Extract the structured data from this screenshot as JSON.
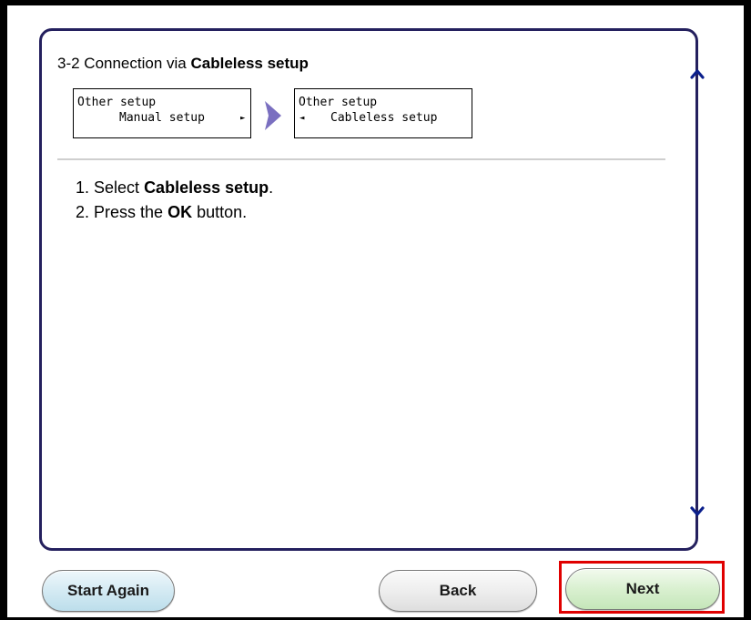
{
  "heading": {
    "prefix": "3-2 Connection via ",
    "bold": "Cableless setup"
  },
  "lcd_before": {
    "line1": "Other setup",
    "line2": "Manual setup",
    "arrow": "►"
  },
  "lcd_after": {
    "line1": "Other setup",
    "line2": "Cableless setup",
    "arrow": "◄"
  },
  "steps": [
    {
      "num": "1.",
      "pre": "Select ",
      "bold": "Cableless setup",
      "post": "."
    },
    {
      "num": "2.",
      "pre": "Press the ",
      "bold": "OK",
      "post": " button."
    }
  ],
  "buttons": {
    "start_again": "Start Again",
    "back": "Back",
    "next": "Next"
  },
  "colors": {
    "panel_border": "#24205e",
    "scroll_arrow": "#0b1f8c",
    "transition_arrow": "#7a6fc0",
    "highlight": "#e00000"
  },
  "icons": {
    "scroll_up": "chevron-up-icon",
    "scroll_down": "chevron-down-icon",
    "transition": "arrow-right-icon"
  }
}
